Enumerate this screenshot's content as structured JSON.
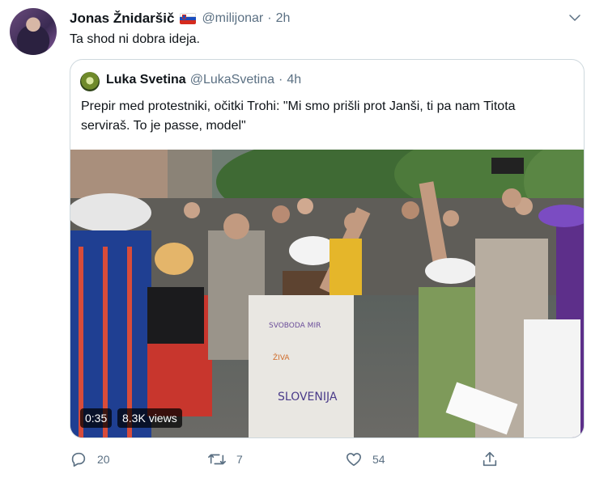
{
  "tweet": {
    "author_name": "Jonas Žnidaršič",
    "author_flag_icon": "slovenia-flag-icon",
    "handle": "@milijonar",
    "separator": "·",
    "time": "2h",
    "text": "Ta shod ni dobra ideja."
  },
  "quote": {
    "author_name": "Luka Svetina",
    "handle": "@LukaSvetina",
    "separator": "·",
    "time": "4h",
    "text": "Prepir med protestniki, očitki Trohi: \"Mi smo prišli prot Janši, ti pa nam Titota serviraš. To je passe, model\"",
    "video": {
      "duration": "0:35",
      "views": "8.3K views"
    }
  },
  "actions": {
    "reply_count": "20",
    "retweet_count": "7",
    "like_count": "54"
  },
  "colors": {
    "text_primary": "#0f1419",
    "text_secondary": "#5b7083",
    "border": "#cfd9de"
  }
}
